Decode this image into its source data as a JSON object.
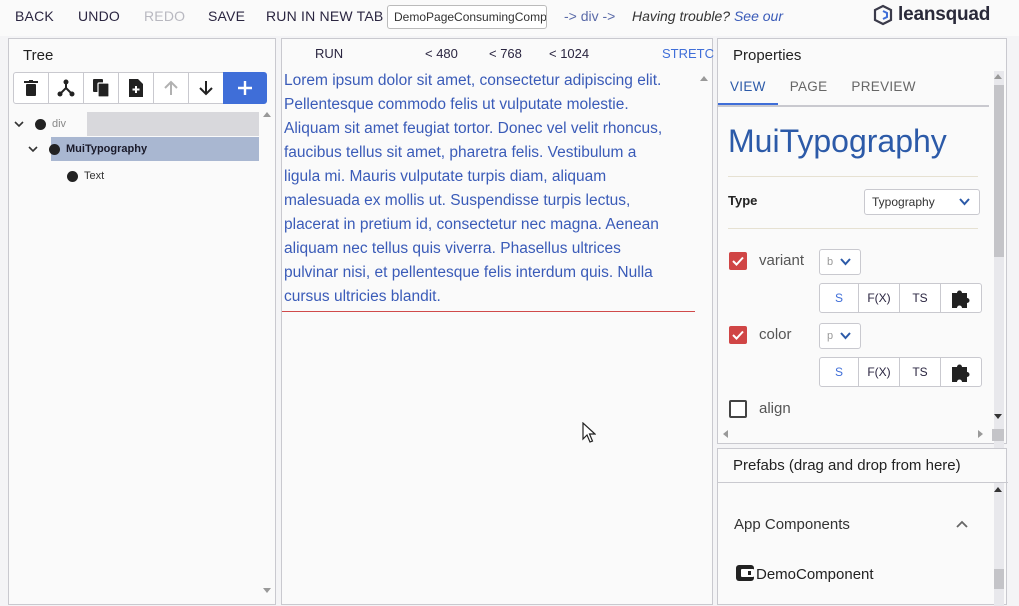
{
  "toolbar": {
    "back": "BACK",
    "undo": "UNDO",
    "redo": "REDO",
    "save": "SAVE",
    "run_new_tab": "RUN IN NEW TAB",
    "page_name": "DemoPageConsumingComp",
    "crumb": "-> div ->",
    "trouble": "Having trouble?",
    "see_our": "See our",
    "logo": "leansquad"
  },
  "tree": {
    "title": "Tree",
    "nodes": [
      {
        "label": "div"
      },
      {
        "label": "MuiTypography"
      },
      {
        "label": "Text"
      }
    ]
  },
  "canvas": {
    "run": "RUN",
    "bp480": "< 480",
    "bp768": "< 768",
    "bp1024": "< 1024",
    "stretch": "STRETC",
    "lines": [
      "Lorem ipsum dolor sit amet, consectetur adipiscing elit.",
      "Pellentesque commodo felis ut vulputate molestie.",
      "Aliquam sit amet feugiat tortor. Donec vel velit rhoncus,",
      "faucibus tellus sit amet, pharetra felis. Vestibulum a",
      "ligula mi. Mauris vulputate turpis diam, aliquam",
      "malesuada ex mollis ut. Suspendisse turpis lectus,",
      "placerat in pretium id, consectetur nec magna. Aenean",
      "aliquam nec tellus quis viverra. Phasellus ultrices",
      "pulvinar nisi, et pellentesque felis interdum quis. Nulla",
      "cursus ultricies blandit."
    ]
  },
  "properties": {
    "title": "Properties",
    "tabs": [
      "VIEW",
      "PAGE",
      "PREVIEW"
    ],
    "component": "MuiTypography",
    "type_label": "Type",
    "type_value": "Typography",
    "variant_label": "variant",
    "variant_value": "b",
    "color_label": "color",
    "color_value": "p",
    "align_label": "align",
    "btn_s": "S",
    "btn_fx": "F(X)",
    "btn_ts": "TS"
  },
  "prefabs": {
    "title": "Prefabs (drag and drop from here)",
    "section": "App Components",
    "item": "DemoComponent"
  },
  "colors": {
    "accent": "#3f6ed8",
    "link": "#3a5bb8",
    "checkbox": "#d04545"
  }
}
